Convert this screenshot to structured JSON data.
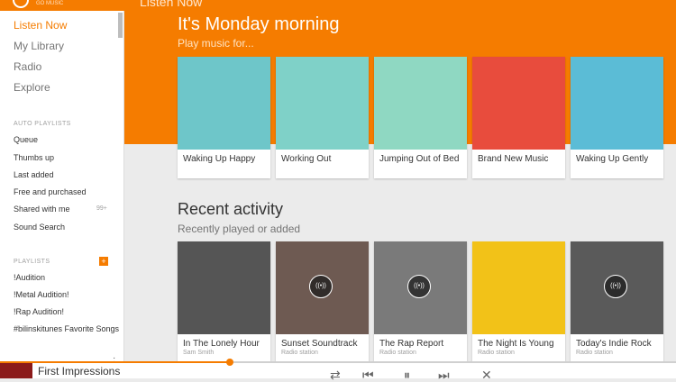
{
  "app": {
    "brand": "GO MUSIC",
    "page_title": "Listen Now"
  },
  "sidebar": {
    "nav": [
      "Listen Now",
      "My Library",
      "Radio",
      "Explore"
    ],
    "auto_playlists_header": "AUTO PLAYLISTS",
    "auto_playlists": [
      "Queue",
      "Thumbs up",
      "Last added",
      "Free and purchased",
      "Shared with me",
      "Sound Search"
    ],
    "shared_badge": "99+",
    "playlists_header": "PLAYLISTS",
    "add_label": "+",
    "playlists": [
      "!Audition",
      "!Metal Audition!",
      "!Rap Audition!",
      "#bilinskitunes Favorite Songs"
    ]
  },
  "banner": {
    "title": "It's Monday morning",
    "subtitle": "Play music for...",
    "cards": [
      {
        "title": "Waking Up Happy",
        "color": "#6ec6c9"
      },
      {
        "title": "Working Out",
        "color": "#7fd1c8"
      },
      {
        "title": "Jumping Out of Bed",
        "color": "#8fd8c2"
      },
      {
        "title": "Brand New Music",
        "color": "#e84c3d"
      },
      {
        "title": "Waking Up Gently",
        "color": "#5bbcd6"
      }
    ]
  },
  "recent": {
    "title": "Recent activity",
    "subtitle": "Recently played or added",
    "cards": [
      {
        "title": "In The Lonely Hour",
        "sub": "Sam Smith",
        "radio": false,
        "color": "#555555"
      },
      {
        "title": "Sunset Soundtrack",
        "sub": "Radio station",
        "radio": true,
        "color": "#6e5a52"
      },
      {
        "title": "The Rap Report",
        "sub": "Radio station",
        "radio": true,
        "color": "#7a7a7a"
      },
      {
        "title": "The Night Is Young",
        "sub": "Radio station",
        "radio": false,
        "color": "#f2c218"
      },
      {
        "title": "Today's Indie Rock",
        "sub": "Radio station",
        "radio": true,
        "color": "#5a5a5a"
      }
    ]
  },
  "player": {
    "track": "First Impressions",
    "progress": 0.34
  }
}
